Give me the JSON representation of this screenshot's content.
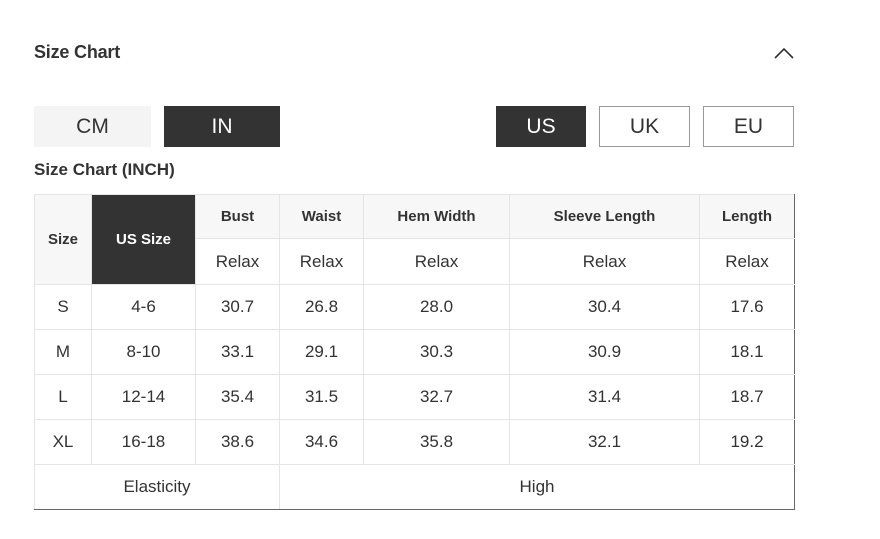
{
  "header": {
    "title": "Size Chart"
  },
  "units": [
    "CM",
    "IN"
  ],
  "active_unit": "IN",
  "regions": [
    "US",
    "UK",
    "EU"
  ],
  "active_region": "US",
  "table_title": "Size Chart (INCH)",
  "columns": {
    "size": "Size",
    "us_size": "US Size",
    "measures": [
      "Bust",
      "Waist",
      "Hem Width",
      "Sleeve Length",
      "Length"
    ],
    "fit": [
      "Relax",
      "Relax",
      "Relax",
      "Relax",
      "Relax"
    ]
  },
  "rows": [
    {
      "size": "S",
      "us": "4-6",
      "values": [
        "30.7",
        "26.8",
        "28.0",
        "30.4",
        "17.6"
      ]
    },
    {
      "size": "M",
      "us": "8-10",
      "values": [
        "33.1",
        "29.1",
        "30.3",
        "30.9",
        "18.1"
      ]
    },
    {
      "size": "L",
      "us": "12-14",
      "values": [
        "35.4",
        "31.5",
        "32.7",
        "31.4",
        "18.7"
      ]
    },
    {
      "size": "XL",
      "us": "16-18",
      "values": [
        "38.6",
        "34.6",
        "35.8",
        "32.1",
        "19.2"
      ]
    }
  ],
  "elasticity": {
    "label": "Elasticity",
    "value": "High"
  },
  "colors": {
    "active": "#333333",
    "inactive_bg": "#f4f4f4",
    "border": "#e5e5e5"
  },
  "icons": {
    "collapse": "chevron-up-icon"
  }
}
